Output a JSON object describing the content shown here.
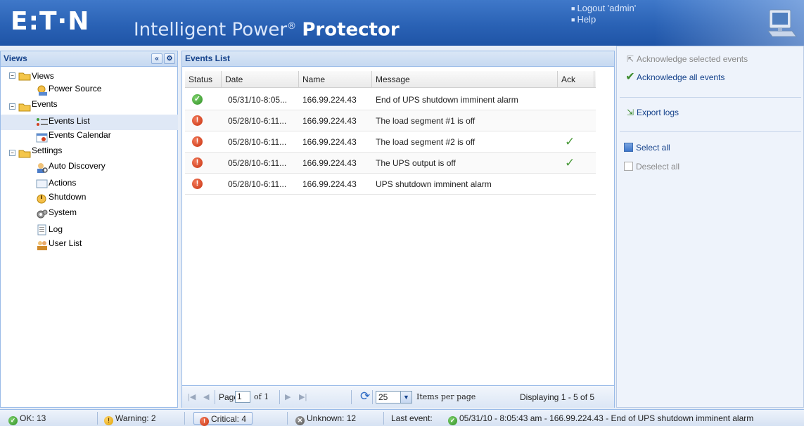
{
  "header": {
    "logo": "E:T·N",
    "title_main": "Intelligent Power",
    "title_reg": "®",
    "title_strong": "Protector",
    "links": [
      "Logout 'admin'",
      "Help"
    ]
  },
  "views": {
    "title": "Views",
    "tree": [
      {
        "label": "Views",
        "icon": "folder-icon"
      },
      {
        "label": "Power Source",
        "icon": "power-source-icon"
      },
      {
        "label": "Events",
        "icon": "folder-icon"
      },
      {
        "label": "Events List",
        "icon": "events-list-icon"
      },
      {
        "label": "Events Calendar",
        "icon": "calendar-icon"
      },
      {
        "label": "Settings",
        "icon": "folder-icon"
      },
      {
        "label": "Auto Discovery",
        "icon": "discovery-icon"
      },
      {
        "label": "Actions",
        "icon": "actions-icon"
      },
      {
        "label": "Shutdown",
        "icon": "shutdown-icon"
      },
      {
        "label": "System",
        "icon": "system-icon"
      },
      {
        "label": "Log",
        "icon": "log-icon"
      },
      {
        "label": "User List",
        "icon": "users-icon"
      }
    ]
  },
  "events": {
    "title": "Events List",
    "columns": [
      "Status",
      "Date",
      "Name",
      "Message",
      "Ack"
    ],
    "rows": [
      {
        "status": "ok",
        "date": "05/31/10-8:05...",
        "name": "166.99.224.43",
        "message": "End of UPS shutdown imminent alarm",
        "ack": ""
      },
      {
        "status": "critical",
        "date": "05/28/10-6:11...",
        "name": "166.99.224.43",
        "message": "The load segment #1 is off",
        "ack": ""
      },
      {
        "status": "critical",
        "date": "05/28/10-6:11...",
        "name": "166.99.224.43",
        "message": "The load segment #2 is off",
        "ack": "✓"
      },
      {
        "status": "critical",
        "date": "05/28/10-6:11...",
        "name": "166.99.224.43",
        "message": "The UPS output is off",
        "ack": "✓"
      },
      {
        "status": "critical",
        "date": "05/28/10-6:11...",
        "name": "166.99.224.43",
        "message": "UPS shutdown imminent alarm",
        "ack": ""
      }
    ],
    "pager": {
      "page_label": "Page",
      "page_value": "1",
      "of_label": "of 1",
      "page_size": "25",
      "items_per_page": "Items per page",
      "displaying": "Displaying 1 - 5 of 5"
    }
  },
  "actions": {
    "ack_selected": "Acknowledge selected events",
    "ack_all": "Acknowledge all events",
    "export_logs": "Export logs",
    "select_all": "Select all",
    "deselect_all": "Deselect all"
  },
  "statusbar": {
    "ok": "OK: 13",
    "warning": "Warning: 2",
    "critical": "Critical: 4",
    "unknown": "Unknown: 12",
    "last_event_label": "Last event:",
    "last_event": "05/31/10 - 8:05:43 am - 166.99.224.43 - End of UPS shutdown imminent alarm"
  },
  "colors": {
    "header_blue": "#2a62b5",
    "panel_border": "#99bbe8",
    "ok_green": "#2f8f24",
    "critical_red": "#c8320f",
    "warning_yellow": "#e0a000"
  }
}
